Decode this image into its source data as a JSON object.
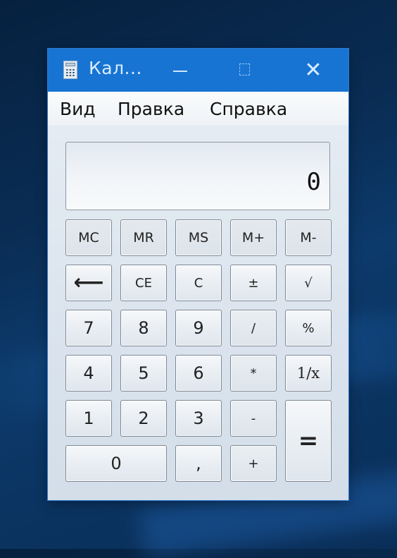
{
  "window": {
    "title": "Кал...",
    "app_icon": "calculator-icon",
    "controls": {
      "minimize": "minimize-icon",
      "maximize": "maximize-icon",
      "close_label": "✕"
    }
  },
  "menu": {
    "items": [
      {
        "label": "Вид"
      },
      {
        "label": "Правка"
      },
      {
        "label": "Справка"
      }
    ]
  },
  "display": {
    "value": "0"
  },
  "keypad": {
    "memory": [
      {
        "label": "MC"
      },
      {
        "label": "MR"
      },
      {
        "label": "MS"
      },
      {
        "label": "M+"
      },
      {
        "label": "M-"
      }
    ],
    "functions": [
      {
        "label": "⟵",
        "icon": "backspace-arrow-icon"
      },
      {
        "label": "CE"
      },
      {
        "label": "C"
      },
      {
        "label": "±"
      },
      {
        "label": "√"
      }
    ],
    "row3": [
      {
        "label": "7"
      },
      {
        "label": "8"
      },
      {
        "label": "9"
      },
      {
        "label": "/"
      },
      {
        "label": "%"
      }
    ],
    "row4": [
      {
        "label": "4"
      },
      {
        "label": "5"
      },
      {
        "label": "6"
      },
      {
        "label": "*"
      },
      {
        "label": "1/x"
      }
    ],
    "row5": [
      {
        "label": "1"
      },
      {
        "label": "2"
      },
      {
        "label": "3"
      },
      {
        "label": "-"
      }
    ],
    "row6": [
      {
        "label": "0"
      },
      {
        "label": ","
      },
      {
        "label": "+"
      }
    ],
    "equals": {
      "label": "="
    }
  },
  "colors": {
    "titlebar": "#1874d2",
    "desktop": "#0a2d55"
  }
}
